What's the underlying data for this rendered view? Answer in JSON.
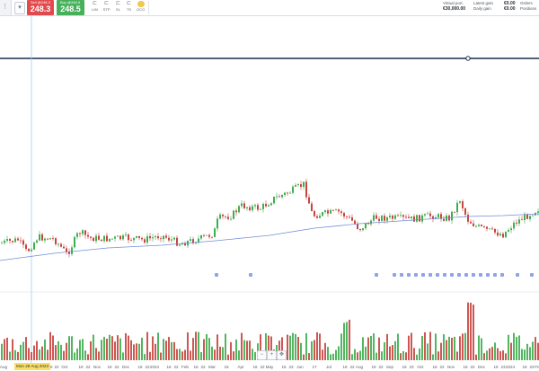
{
  "toolbar": {
    "menu_glyph": "⋮",
    "dropdown_glyph": "▾",
    "sell_label": "Sell @248.3",
    "sell_price": "248.3",
    "buy_label": "Buy @248.5",
    "buy_price": "248.5",
    "tools": [
      {
        "label": "LIM",
        "icon": "limit-order-icon",
        "glyph": "⊏"
      },
      {
        "label": "STP",
        "icon": "stop-order-icon",
        "glyph": "⊏"
      },
      {
        "label": "SL",
        "icon": "stop-loss-icon",
        "glyph": "⊏"
      },
      {
        "label": "TS",
        "icon": "trailing-stop-icon",
        "glyph": "⊏"
      },
      {
        "label": "OCO",
        "icon": "oco-order-icon",
        "glyph": ""
      }
    ]
  },
  "account": {
    "virtual_port_label": "Virtual port.",
    "virtual_port_value": "€30,000.00",
    "latest_gain_label": "Latest gain",
    "latest_gain_value": "€0.00",
    "daily_gain_label": "Daily gain",
    "daily_gain_value": "€0.00",
    "orders_label": "Orders",
    "positions_label": "Positions"
  },
  "colors": {
    "up": "#3fae4f",
    "down": "#c8453f",
    "moving_average": "#6f8fd6",
    "price_line": "#1c2c4a",
    "sell": "#e14a4d",
    "buy": "#46b05a",
    "event_marker": "#8fa4e6",
    "crosshair": "#9fd0f0"
  },
  "crosshair_date": "Mon 28 Aug 2023",
  "x_axis_labels": [
    "Aug",
    "Mon 28 Aug 2023",
    "16",
    "22",
    "Oct",
    "16",
    "22",
    "Nov",
    "16",
    "22",
    "Dec",
    "16",
    "22",
    "2024",
    "16",
    "22",
    "Feb",
    "16",
    "22",
    "Mar",
    "16",
    "Apr",
    "16",
    "22",
    "May",
    "16",
    "23",
    "Jun",
    "17",
    "Jul",
    "16",
    "22",
    "Aug",
    "16",
    "22",
    "Sep",
    "16",
    "23",
    "Oct",
    "16",
    "22",
    "Nov",
    "16",
    "22",
    "Dec",
    "16",
    "23",
    "2024",
    "16",
    "23",
    "Fe"
  ],
  "zoom_controls": [
    {
      "name": "zoom-out-button",
      "glyph": "−"
    },
    {
      "name": "zoom-in-button",
      "glyph": "+"
    },
    {
      "name": "pan-button",
      "glyph": "✥"
    }
  ],
  "chart_data": {
    "type": "candlestick",
    "series": [
      {
        "name": "",
        "kind": "price"
      },
      {
        "name": "",
        "kind": "moving-average"
      },
      {
        "name": "",
        "kind": "volume"
      }
    ],
    "price_start": 248.3,
    "notes": "Daily candles with a long moving-average line, a horizontal price line, event markers and volume bars."
  }
}
